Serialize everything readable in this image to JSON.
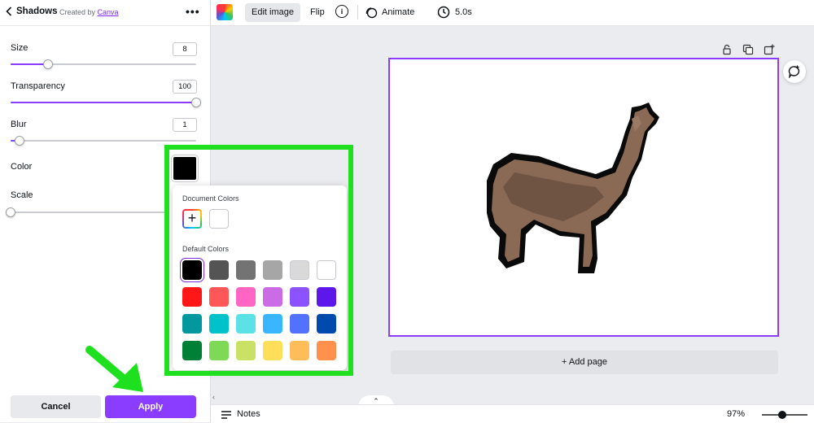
{
  "panel": {
    "title": "Shadows",
    "credit_prefix": "Created by",
    "credit_link": "Canva",
    "controls": {
      "size": {
        "label": "Size",
        "value": "8",
        "fraction": 0.2
      },
      "transparency": {
        "label": "Transparency",
        "value": "100",
        "fraction": 1.0
      },
      "blur": {
        "label": "Blur",
        "value": "1",
        "fraction": 0.05
      },
      "color": {
        "label": "Color",
        "value_hex": "#000000"
      },
      "scale": {
        "label": "Scale",
        "fraction": 0.0
      }
    },
    "cancel_label": "Cancel",
    "apply_label": "Apply"
  },
  "toolbar": {
    "edit_image_label": "Edit image",
    "flip_label": "Flip",
    "info_glyph": "i",
    "animate_label": "Animate",
    "duration_label": "5.0s"
  },
  "color_picker": {
    "document_heading": "Document Colors",
    "document_colors": [
      "#ffffff"
    ],
    "add_glyph": "+",
    "default_heading": "Default Colors",
    "default_colors": [
      "#000000",
      "#545454",
      "#737373",
      "#a6a6a6",
      "#d9d9d9",
      "#ffffff",
      "#ff1616",
      "#ff5757",
      "#ff66c4",
      "#cb6ce6",
      "#8c52ff",
      "#5e17eb",
      "#03989e",
      "#00c2cb",
      "#5ce1e6",
      "#38b6ff",
      "#5271ff",
      "#004aad",
      "#008037",
      "#7ed957",
      "#c9e265",
      "#ffde59",
      "#ffbd59",
      "#ff914d"
    ],
    "selected_index": 0
  },
  "canvas": {
    "add_page_label": "+ Add page"
  },
  "bottombar": {
    "notes_label": "Notes",
    "zoom_label": "97%"
  },
  "colors": {
    "accent": "#8b3dff",
    "highlight": "#1ee01e"
  }
}
